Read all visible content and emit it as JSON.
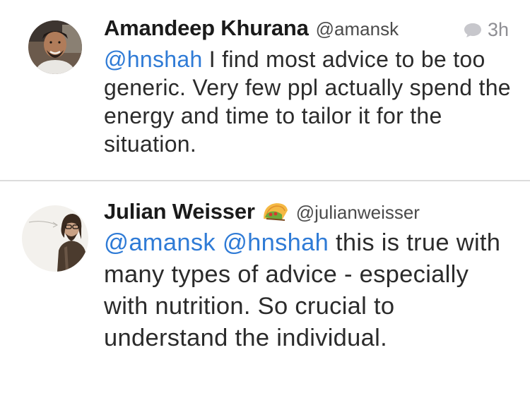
{
  "tweets": [
    {
      "display_name": "Amandeep Khurana",
      "handle": "@amansk",
      "timestamp": "3h",
      "reply_icon": "speech-bubble-icon",
      "mentions": [
        "@hnshah"
      ],
      "text": " I find most advice to be too generic. Very few ppl actually spend the energy and time to tailor it for the situation."
    },
    {
      "display_name": "Julian Weisser",
      "emoji": "taco-icon",
      "handle": "@julianweisser",
      "mentions": [
        "@amansk",
        "@hnshah"
      ],
      "text": " this is true with many types of advice - especially with nutrition. So crucial to understand the individual."
    }
  ],
  "colors": {
    "mention": "#2f7bd6",
    "name": "#1a1a1a",
    "handle": "#4a4a4a",
    "body": "#2b2b2b",
    "meta": "#8e8e93",
    "divider": "#dcdcdc"
  }
}
